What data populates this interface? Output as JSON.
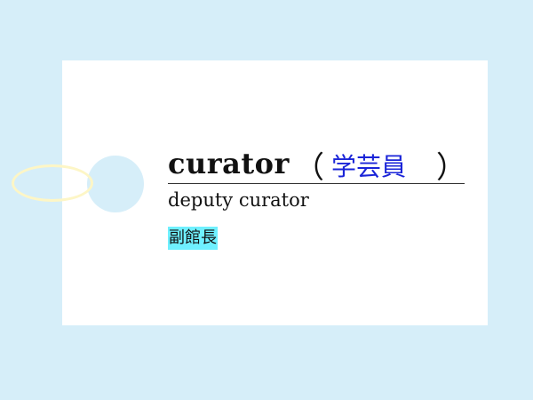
{
  "card": {
    "headword": "curator",
    "open_paren": "（",
    "translation": "学芸員",
    "close_paren": "）",
    "subword": "deputy curator",
    "subtranslation": "副館長"
  },
  "colors": {
    "background": "#d6eef9",
    "card": "#ffffff",
    "translation": "#1a24d8",
    "highlight": "#6ff0ff",
    "string": "#fdf6c6"
  }
}
